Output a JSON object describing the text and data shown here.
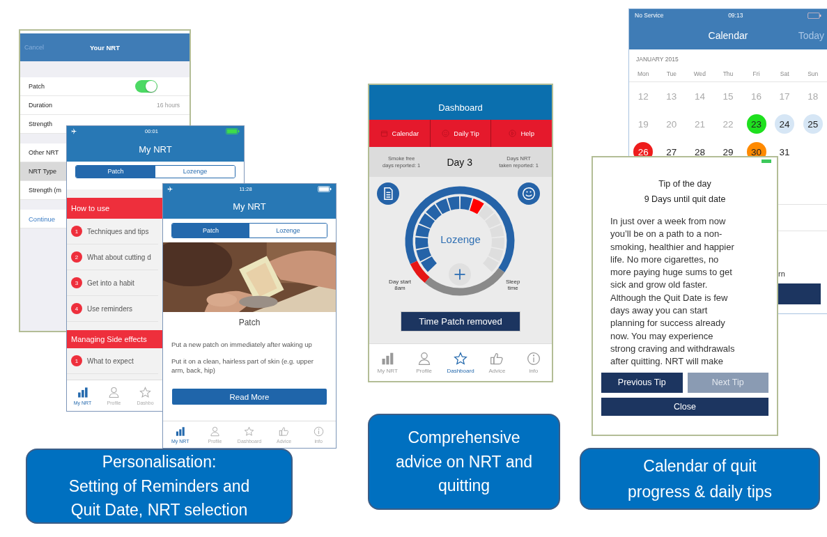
{
  "your_nrt_screen": {
    "cancel": "Cancel",
    "title": "Your NRT",
    "groups": [
      [
        {
          "label": "Patch",
          "kind": "toggle",
          "on": true,
          "selected": false
        },
        {
          "label": "Duration",
          "kind": "value",
          "value": "16 hours",
          "selected": false
        },
        {
          "label": "Strength",
          "kind": "plain",
          "selected": false
        }
      ],
      [
        {
          "label": "Other NRT",
          "kind": "plain",
          "selected": false
        },
        {
          "label": "NRT Type",
          "kind": "plain",
          "selected": true
        },
        {
          "label": "Strength (m",
          "kind": "plain",
          "selected": false
        }
      ]
    ],
    "link": "Continue"
  },
  "my_nrt_list_screen": {
    "time": "00:01",
    "title": "My NRT",
    "segments": [
      {
        "label": "Patch",
        "selected": true
      },
      {
        "label": "Lozenge",
        "selected": false
      }
    ],
    "sections": [
      {
        "title": "How to use",
        "items": [
          {
            "number": "1",
            "label": "Techniques and tips"
          },
          {
            "number": "2",
            "label": "What about cutting d"
          },
          {
            "number": "3",
            "label": "Get into a habit"
          },
          {
            "number": "4",
            "label": "Use reminders"
          }
        ]
      },
      {
        "title": "Managing Side effects",
        "items": [
          {
            "number": "1",
            "label": "What to expect"
          }
        ]
      }
    ],
    "tabs": [
      {
        "label": "My NRT",
        "selected": true
      },
      {
        "label": "Profile",
        "selected": false
      },
      {
        "label": "Dashbo",
        "selected": false
      }
    ]
  },
  "my_nrt_detail_screen": {
    "time": "11:28",
    "title": "My NRT",
    "segments": [
      {
        "label": "Patch",
        "selected": true
      },
      {
        "label": "Lozenge",
        "selected": false
      }
    ],
    "photo": {
      "kind": "picture"
    },
    "heading": "Patch",
    "paragraphs": [
      "Put a new patch on immediately after waking up",
      "Put it on a clean, hairless part of skin (e.g. upper arm, back, hip)"
    ],
    "button": "Read More",
    "tabs": [
      {
        "label": "My NRT",
        "selected": true
      },
      {
        "label": "Profile",
        "selected": false
      },
      {
        "label": "Dashboard",
        "selected": false
      },
      {
        "label": "Advice",
        "selected": false
      },
      {
        "label": "info",
        "selected": false
      }
    ]
  },
  "dashboard_screen": {
    "title": "Dashboard",
    "actions": [
      "Calendar",
      "Daily Tip",
      "Help"
    ],
    "stat_left": "Smoke free\ndays reported: 1",
    "day": "Day 3",
    "stat_right": "Days NRT\ntaken reported: 1",
    "gauge_label": "Lozenge",
    "start_label": "Day start\n8am",
    "end_label": "Sleep\ntime",
    "button": "Time Patch removed",
    "tabs": [
      {
        "label": "My NRT",
        "selected": false
      },
      {
        "label": "Profile",
        "selected": false
      },
      {
        "label": "Dashboard",
        "selected": true
      },
      {
        "label": "Advice",
        "selected": false
      },
      {
        "label": "info",
        "selected": false
      }
    ]
  },
  "calendar_screen": {
    "carrier": "No Service",
    "time": "09:13",
    "title": "Calendar",
    "today": "Today",
    "month": "JANUARY 2015",
    "weekdays": [
      "Mon",
      "Tue",
      "Wed",
      "Thu",
      "Fri",
      "Sat",
      "Sun"
    ],
    "weeks": [
      [
        {
          "day": "12",
          "past": true
        },
        {
          "day": "13",
          "past": true
        },
        {
          "day": "14",
          "past": true
        },
        {
          "day": "15",
          "past": true
        },
        {
          "day": "16",
          "past": true
        },
        {
          "day": "17",
          "past": true
        },
        {
          "day": "18",
          "past": true
        }
      ],
      [
        {
          "day": "19",
          "past": true
        },
        {
          "day": "20",
          "past": true
        },
        {
          "day": "21",
          "past": true
        },
        {
          "day": "22",
          "past": true
        },
        {
          "day": "23",
          "past": false,
          "color": "#1ee01e"
        },
        {
          "day": "24",
          "past": false,
          "color": "#d6e6f5"
        },
        {
          "day": "25",
          "past": false,
          "color": "#d6e6f5"
        }
      ],
      [
        {
          "day": "26",
          "past": false,
          "color": "#ee1c1c"
        },
        {
          "day": "27",
          "past": false
        },
        {
          "day": "28",
          "past": false
        },
        {
          "day": "29",
          "past": false
        },
        {
          "day": "30",
          "past": false,
          "color": "#ff8a00"
        },
        {
          "day": "31",
          "past": false
        }
      ]
    ],
    "fragment": "rn"
  },
  "tip_dialog": {
    "title": "Tip of the day",
    "subtitle": "9 Days until quit date",
    "body": "In just over a week from now\nyou’ll be on a path to a non-\nsmoking, healthier and happier\nlife. No more cigarettes, no\nmore paying huge sums to get\nsick and grow old faster.\nAlthough the Quit Date is few\ndays away you can start\nplanning for success already\nnow. You may experience\nstrong craving and withdrawals\nafter quitting. NRT will make",
    "buttons": [
      {
        "label": "Previous Tip",
        "disabled": false
      },
      {
        "label": "Next Tip",
        "disabled": true
      }
    ],
    "close": "Close"
  },
  "captions": [
    "Personalisation:\nSetting of Reminders and\nQuit Date, NRT selection",
    "Comprehensive\nadvice on NRT and\nquitting",
    "Calendar of quit\nprogress & daily tips"
  ]
}
